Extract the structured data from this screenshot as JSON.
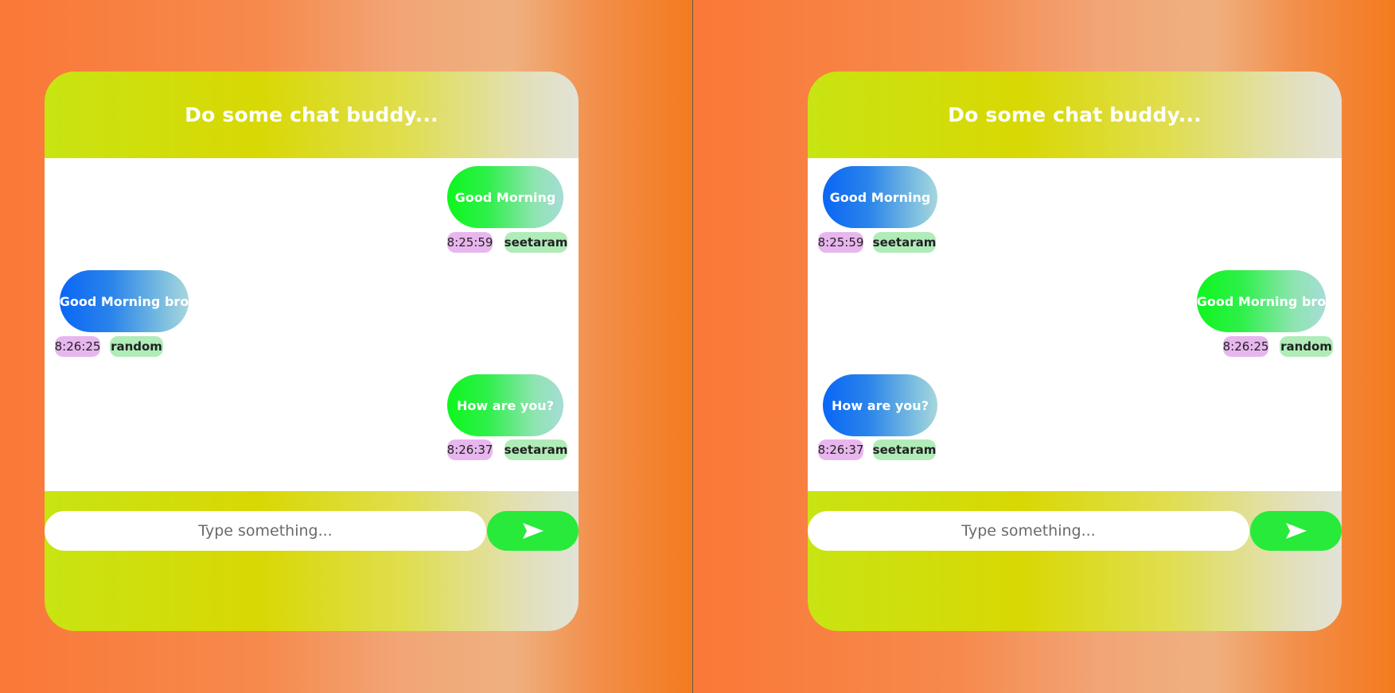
{
  "header": {
    "title": "Do some chat buddy..."
  },
  "composer": {
    "placeholder": "Type something...",
    "send_icon": "send-arrow-icon"
  },
  "colors": {
    "sent_bubble": "#0ef61e",
    "received_bubble": "#0a66f6",
    "time_pill": "#e8b6ee",
    "user_pill": "#b0ecb8",
    "send_button": "#28ea3a"
  },
  "left_window": {
    "messages": [
      {
        "text": "Good Morning",
        "time": "8:25:59",
        "user": "seetaram",
        "side": "right"
      },
      {
        "text": "Good Morning bro",
        "time": "8:26:25",
        "user": "random",
        "side": "left"
      },
      {
        "text": "How are you?",
        "time": "8:26:37",
        "user": "seetaram",
        "side": "right"
      }
    ]
  },
  "right_window": {
    "messages": [
      {
        "text": "Good Morning",
        "time": "8:25:59",
        "user": "seetaram",
        "side": "left"
      },
      {
        "text": "Good Morning bro",
        "time": "8:26:25",
        "user": "random",
        "side": "right"
      },
      {
        "text": "How are you?",
        "time": "8:26:37",
        "user": "seetaram",
        "side": "left"
      }
    ]
  }
}
